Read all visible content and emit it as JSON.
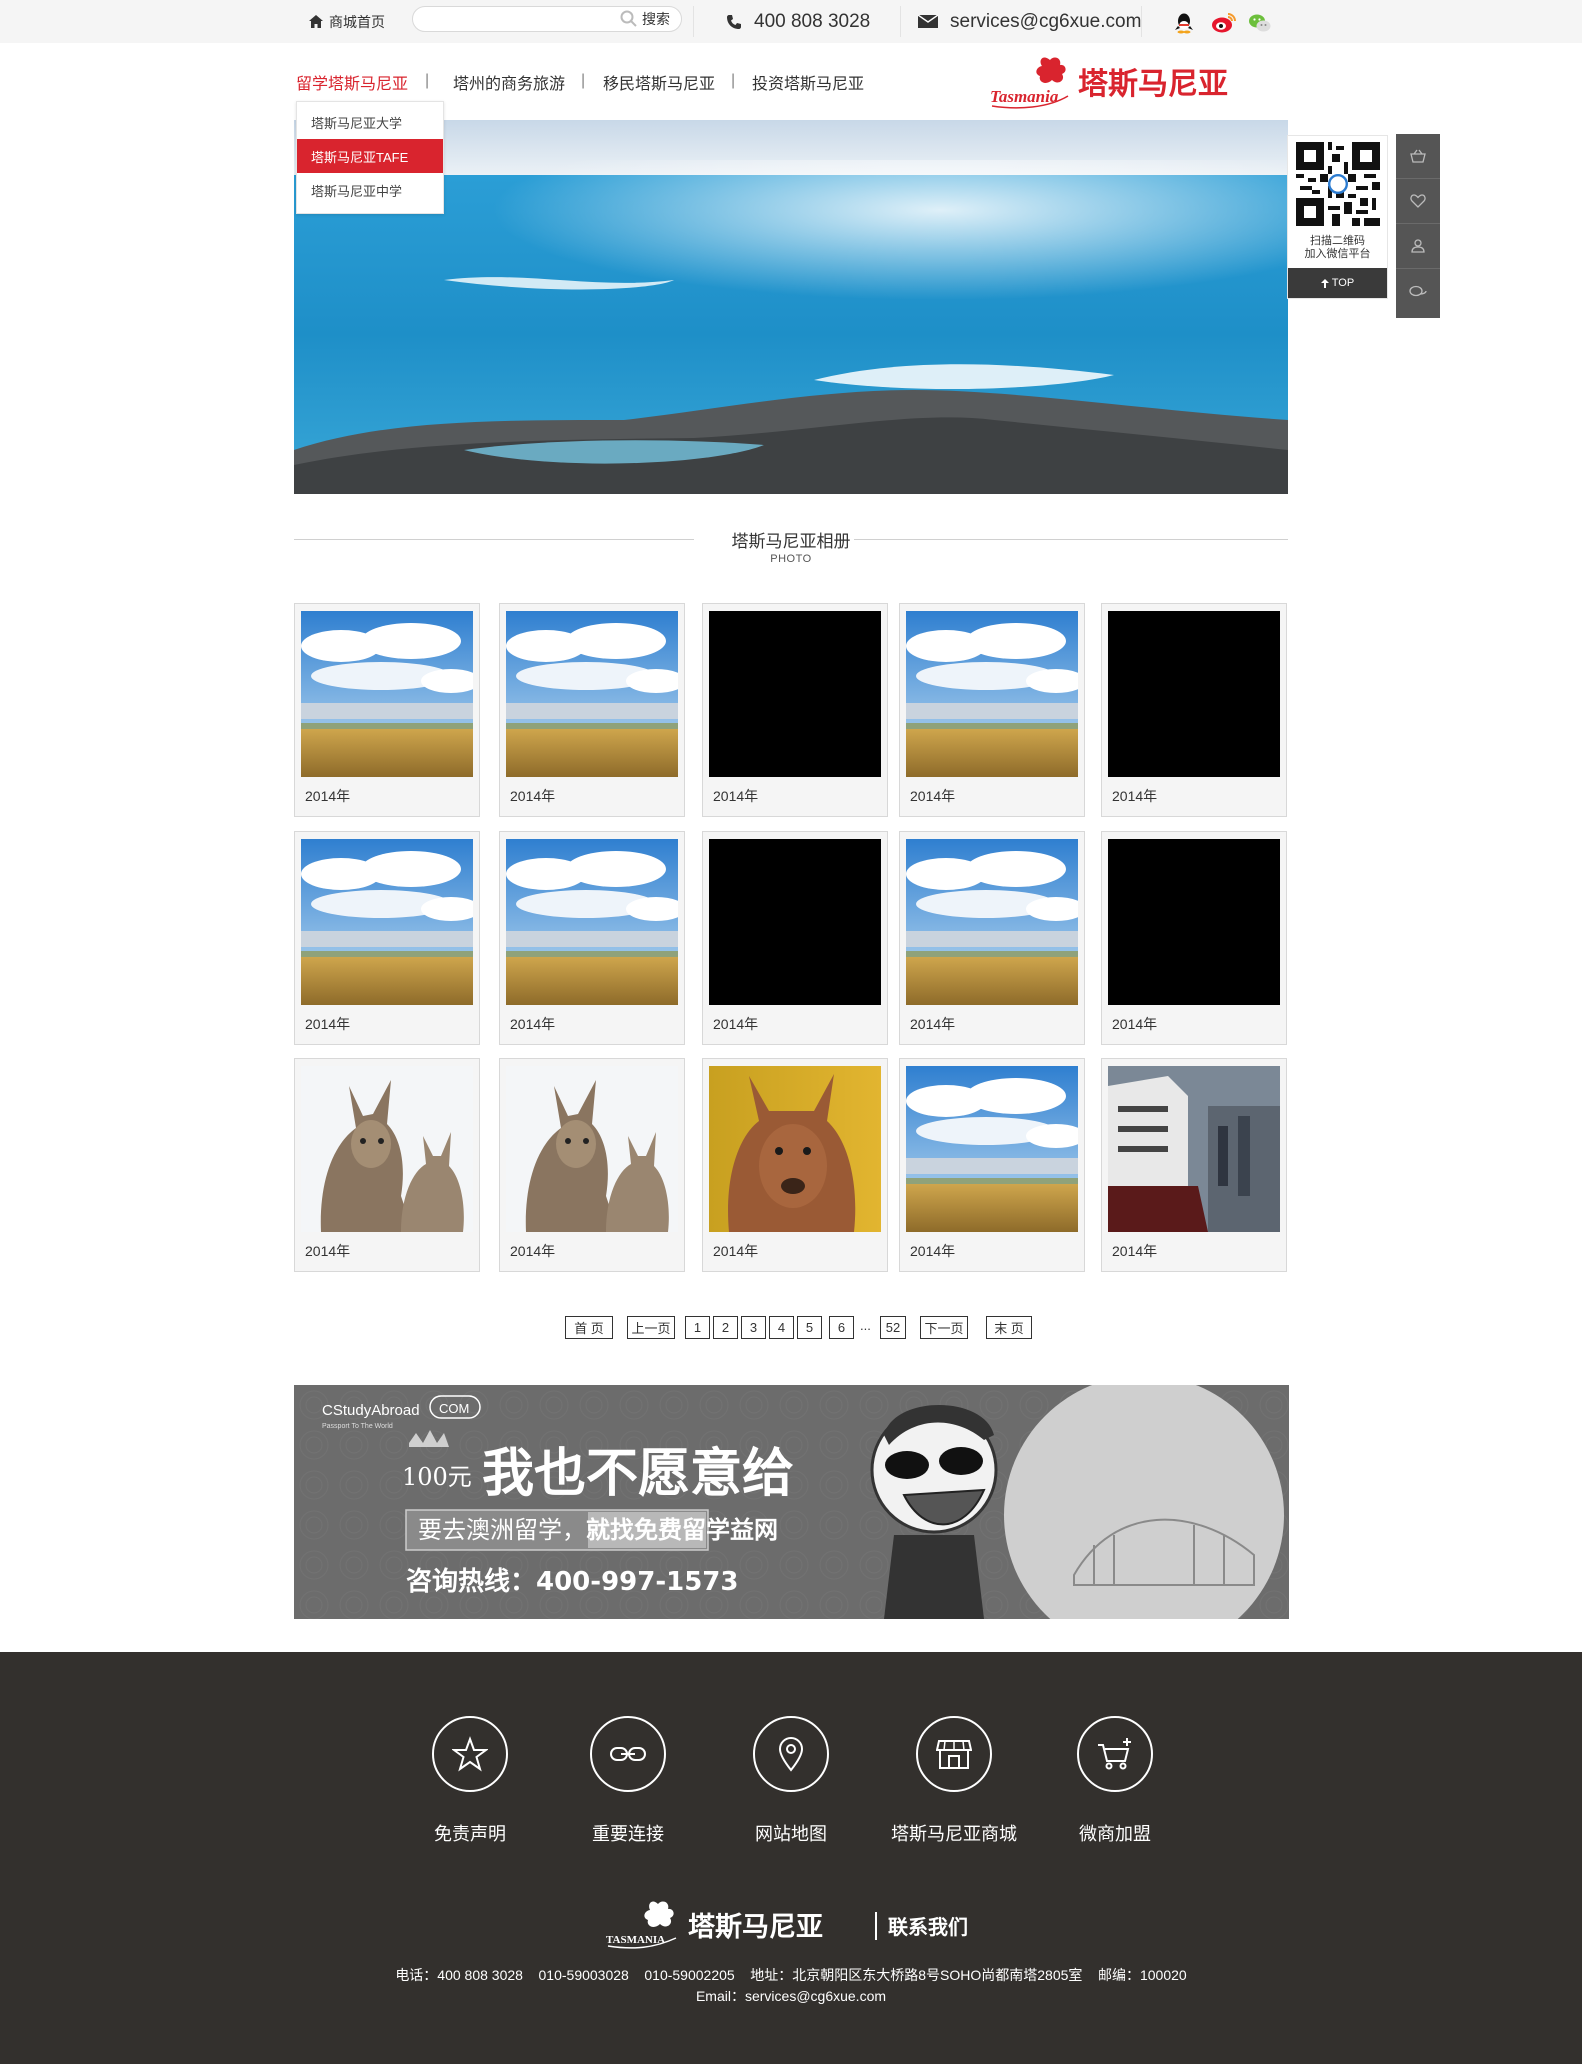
{
  "topbar": {
    "home_label": "商城首页",
    "search_placeholder": "",
    "search_label": "搜索",
    "phone": "400 808 3028",
    "email": "services@cg6xue.com",
    "social_icons": [
      "qq-icon",
      "weibo-icon",
      "wechat-icon"
    ]
  },
  "nav": {
    "items": [
      {
        "label": "留学塔斯马尼亚",
        "active": true
      },
      {
        "label": "塔州的商务旅游"
      },
      {
        "label": "移民塔斯马尼亚"
      },
      {
        "label": "投资塔斯马尼亚"
      }
    ],
    "separator": "|",
    "dropdown": [
      {
        "label": "塔斯马尼亚大学"
      },
      {
        "label": "塔斯马尼亚TAFE",
        "selected": true
      },
      {
        "label": "塔斯马尼亚中学"
      }
    ]
  },
  "logo": {
    "en": "Tasmania",
    "cn": "塔斯马尼亚"
  },
  "qr": {
    "line1": "扫描二维码",
    "line2": "加入微信平台",
    "top_label": "TOP"
  },
  "sidebar_icons": [
    "basket-icon",
    "heart-icon",
    "user-icon",
    "chat-icon"
  ],
  "section": {
    "title": "塔斯马尼亚相册",
    "subtitle": "PHOTO"
  },
  "gallery": [
    {
      "caption": "2014年",
      "img": "field"
    },
    {
      "caption": "2014年",
      "img": "field"
    },
    {
      "caption": "2014年",
      "img": "black"
    },
    {
      "caption": "2014年",
      "img": "field"
    },
    {
      "caption": "2014年",
      "img": "black"
    },
    {
      "caption": "2014年",
      "img": "field"
    },
    {
      "caption": "2014年",
      "img": "field"
    },
    {
      "caption": "2014年",
      "img": "black"
    },
    {
      "caption": "2014年",
      "img": "field"
    },
    {
      "caption": "2014年",
      "img": "black"
    },
    {
      "caption": "2014年",
      "img": "wallaby"
    },
    {
      "caption": "2014年",
      "img": "wallaby"
    },
    {
      "caption": "2014年",
      "img": "kangaroo"
    },
    {
      "caption": "2014年",
      "img": "field"
    },
    {
      "caption": "2014年",
      "img": "ship"
    }
  ],
  "pagination": {
    "first": "首 页",
    "prev": "上一页",
    "pages": [
      "1",
      "2",
      "3",
      "4",
      "5",
      "6"
    ],
    "ellipsis": "...",
    "last_page": "52",
    "next": "下一页",
    "last": "末 页"
  },
  "ad": {
    "brand": "CStudyAbroad",
    "brand_suffix": "COM",
    "brand_tagline": "Passport To The World",
    "price": "100元",
    "headline": "我也不愿意给",
    "sub_left": "要去澳洲留学，",
    "sub_right": "就找免费留学益网",
    "hotline": "咨询热线：400-997-1573"
  },
  "footer": {
    "links": [
      {
        "label": "免责声明",
        "icon": "star-icon"
      },
      {
        "label": "重要连接",
        "icon": "link-icon"
      },
      {
        "label": "网站地图",
        "icon": "map-pin-icon"
      },
      {
        "label": "塔斯马尼亚商城",
        "icon": "store-icon"
      },
      {
        "label": "微商加盟",
        "icon": "cart-plus-icon"
      }
    ],
    "logo_en": "TASMANIA",
    "logo_cn": "塔斯马尼亚",
    "contact_us": "联系我们",
    "contact_line1": "电话：400 808 3028    010-59003028    010-59002205    地址：北京朝阳区东大桥路8号SOHO尚都南塔2805室    邮编：100020",
    "contact_line2": "Email：services@cg6xue.com"
  }
}
